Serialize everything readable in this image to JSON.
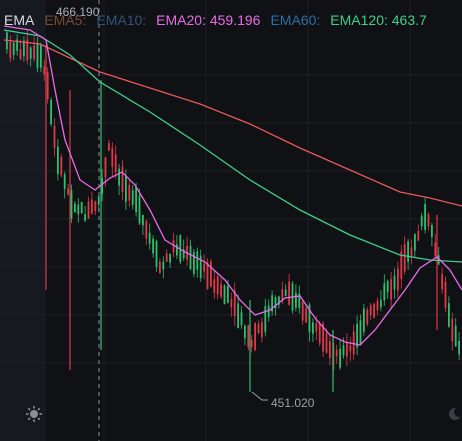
{
  "legend": {
    "title": "EMA",
    "ema5": "EMA5:",
    "ema10": "EMA10:",
    "ema20": "EMA20: 459.196",
    "ema60": "EMA60:",
    "ema120": "EMA120: 463.7"
  },
  "crosshair_price": "466.190",
  "low_price_label": "451.020",
  "colors": {
    "background": "#0f1114",
    "grid": "#1c1f24",
    "up": "#2fbf71",
    "down": "#e0394a",
    "ema20": "#e86be6",
    "ema60": "#2e6da4",
    "ema120": "#3ecf8e",
    "ema_long": "#e8575a",
    "ema5": "#8a4a2e",
    "ema10": "#35557a"
  },
  "icons": {
    "settings": "sun-gear-icon",
    "corner": "moon-icon"
  },
  "chart_data": {
    "type": "candlestick",
    "title": "",
    "visible_price_labels": [
      "466.190",
      "451.020"
    ],
    "series": [
      {
        "name": "EMA20",
        "value": 459.196
      },
      {
        "name": "EMA120",
        "value": 463.7
      }
    ]
  }
}
